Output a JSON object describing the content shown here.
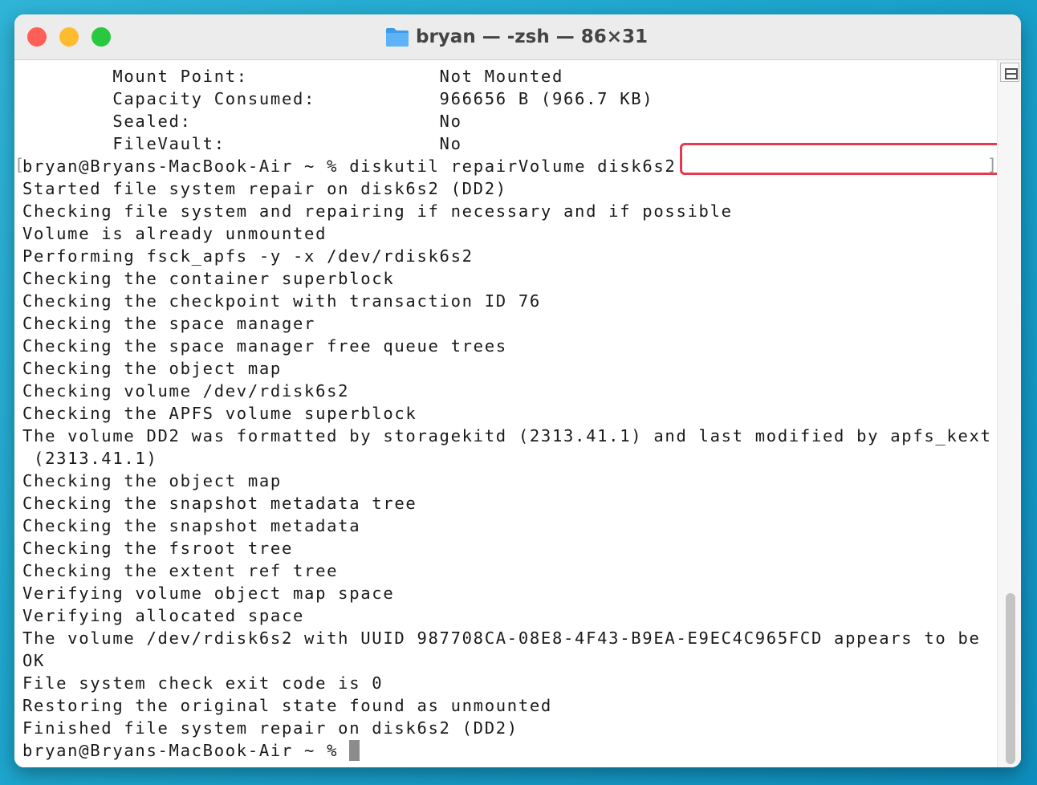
{
  "window": {
    "title": "bryan — -zsh — 86×31",
    "colors": {
      "close": "#ff5f57",
      "minimize": "#febc2e",
      "zoom": "#28c840",
      "highlight_border": "#e8384f",
      "folder": "#4aa8f0"
    }
  },
  "terminal": {
    "lines": [
      "        Mount Point:                 Not Mounted",
      "        Capacity Consumed:           966656 B (966.7 KB)",
      "        Sealed:                      No",
      "        FileVault:                   No",
      "Started file system repair on disk6s2 (DD2)",
      "Checking file system and repairing if necessary and if possible",
      "Volume is already unmounted",
      "Performing fsck_apfs -y -x /dev/rdisk6s2",
      "Checking the container superblock",
      "Checking the checkpoint with transaction ID 76",
      "Checking the space manager",
      "Checking the space manager free queue trees",
      "Checking the object map",
      "Checking volume /dev/rdisk6s2",
      "Checking the APFS volume superblock",
      "The volume DD2 was formatted by storagekitd (2313.41.1) and last modified by apfs_kext",
      " (2313.41.1)",
      "Checking the object map",
      "Checking the snapshot metadata tree",
      "Checking the snapshot metadata",
      "Checking the fsroot tree",
      "Checking the extent ref tree",
      "Verifying volume object map space",
      "Verifying allocated space",
      "The volume /dev/rdisk6s2 with UUID 987708CA-08E8-4F43-B9EA-E9EC4C965FCD appears to be",
      "OK",
      "File system check exit code is 0",
      "Restoring the original state found as unmounted",
      "Finished file system repair on disk6s2 (DD2)"
    ],
    "prompt": "bryan@Bryans-MacBook-Air ~ % ",
    "command": "diskutil repairVolume disk6s2",
    "final_prompt": "bryan@Bryans-MacBook-Air ~ % ",
    "mark_left": "[",
    "mark_right": "]"
  }
}
